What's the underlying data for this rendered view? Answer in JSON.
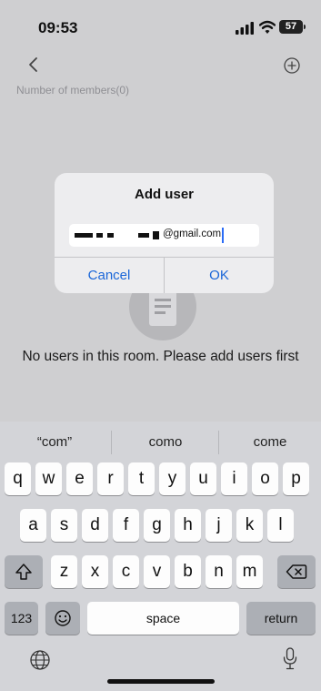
{
  "status_bar": {
    "time": "09:53",
    "battery": "57"
  },
  "header": {
    "members_label": "Number of members(0)"
  },
  "empty_state": {
    "message": "No users in this room. Please add users first"
  },
  "dialog": {
    "title": "Add user",
    "input_value": "@gmail.com",
    "cancel_label": "Cancel",
    "ok_label": "OK"
  },
  "keyboard": {
    "suggestions": [
      "“com”",
      "como",
      "come"
    ],
    "row1": [
      "q",
      "w",
      "e",
      "r",
      "t",
      "y",
      "u",
      "i",
      "o",
      "p"
    ],
    "row2": [
      "a",
      "s",
      "d",
      "f",
      "g",
      "h",
      "j",
      "k",
      "l"
    ],
    "row3": [
      "z",
      "x",
      "c",
      "v",
      "b",
      "n",
      "m"
    ],
    "numbers_label": "123",
    "space_label": "space",
    "return_label": "return"
  },
  "colors": {
    "accent": "#1a66d8",
    "caret": "#2b6cf6"
  },
  "icons": [
    "back-chevron-icon",
    "add-circle-icon",
    "signal-icon",
    "wifi-icon",
    "battery-icon",
    "document-icon",
    "shift-icon",
    "delete-icon",
    "emoji-icon",
    "globe-icon",
    "mic-icon"
  ]
}
